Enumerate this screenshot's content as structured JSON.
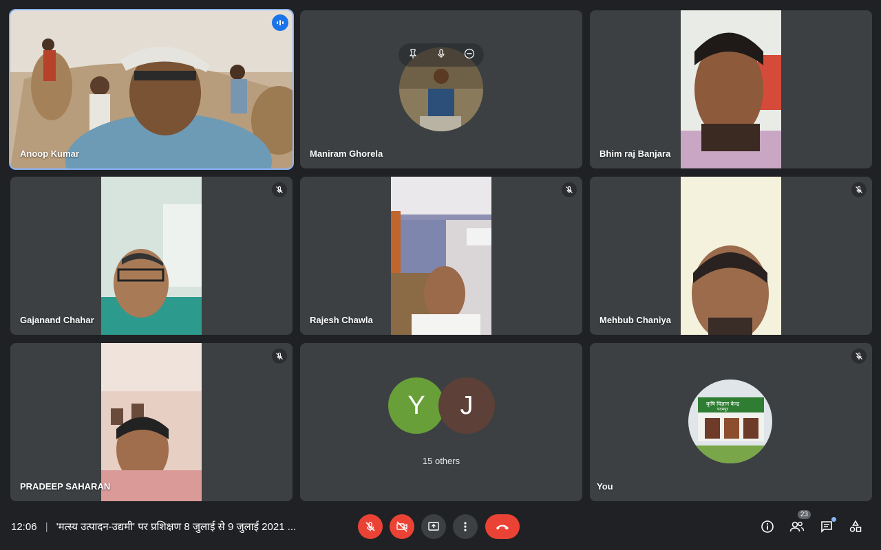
{
  "participants": [
    {
      "name": "Anoop Kumar",
      "speaking": true,
      "muted": false
    },
    {
      "name": "Maniram Ghorela",
      "muted": false
    },
    {
      "name": "Bhim raj Banjara",
      "muted": false
    },
    {
      "name": "Gajanand Chahar",
      "muted": true
    },
    {
      "name": "Rajesh Chawla",
      "muted": true
    },
    {
      "name": "Mehbub Chaniya",
      "muted": true
    },
    {
      "name": "PRADEEP SAHARAN",
      "muted": true
    },
    {
      "name": "You",
      "muted": true
    }
  ],
  "others_tile": {
    "avatars": [
      {
        "letter": "Y",
        "color": "#689f38"
      },
      {
        "letter": "J",
        "color": "#5d4037"
      }
    ],
    "label": "15 others"
  },
  "self_avatar_text": {
    "line1": "कृषि विज्ञान केन्द्र",
    "line2": "पदमपुर"
  },
  "bottom_bar": {
    "time": "12:06",
    "separator": "|",
    "meeting_title": "'मत्स्य उत्पादन-उद्यमी' पर प्रशिक्षण 8 जुलाई से 9 जुलाई 2021 ...",
    "people_count": "23"
  },
  "colors": {
    "background": "#202124",
    "tile": "#3c4043",
    "accent_blue": "#8ab4f8",
    "danger_red": "#ea4335"
  }
}
